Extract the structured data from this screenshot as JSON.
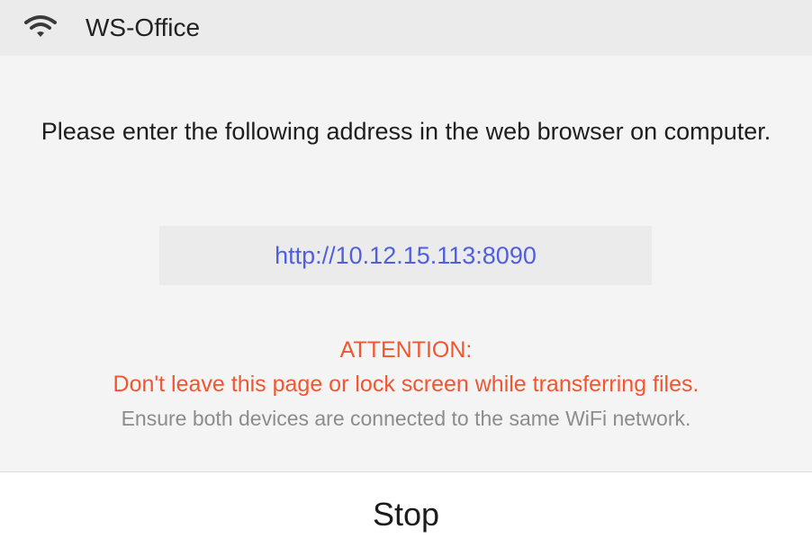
{
  "header": {
    "network_name": "WS-Office",
    "icon": "wifi-icon"
  },
  "main": {
    "instruction": "Please enter the following address in the web browser on computer.",
    "address": "http://10.12.15.113:8090",
    "attention_title": "ATTENTION:",
    "attention_text": "Don't leave this page or lock screen while transferring files.",
    "ensure_text": "Ensure both devices are connected to the same WiFi network."
  },
  "footer": {
    "stop_label": "Stop"
  },
  "colors": {
    "address": "#4f5fe0",
    "attention": "#f2562e",
    "muted": "#8c8c8c"
  }
}
